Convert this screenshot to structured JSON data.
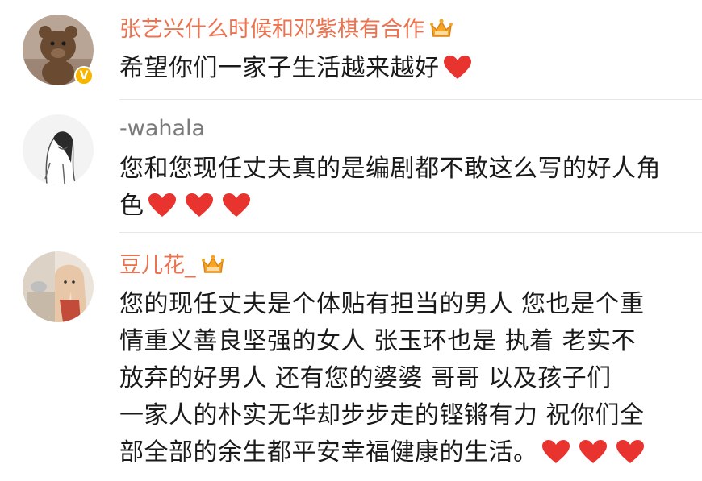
{
  "comments": [
    {
      "username": "张艺兴什么时候和邓紫棋有合作",
      "lines": [
        "希望你们一家子生活越来越好"
      ],
      "badge": "V",
      "heart_count": 1
    },
    {
      "username": "-wahala",
      "lines": [
        "您和您现任丈夫真的是编剧都不敢这么写的好人角",
        "色"
      ],
      "heart_count": 3
    },
    {
      "username": "豆儿花_",
      "lines": [
        "您的现任丈夫是个体贴有担当的男人  您也是个重",
        "情重义善良坚强的女人   张玉环也是 执着 老实不",
        "放弃的好男人  还有您的婆婆  哥哥  以及孩子们",
        "一家人的朴实无华却步步走的铿锵有力  祝你们全",
        "部全部的余生都平安幸福健康的生活。"
      ],
      "heart_count": 3
    }
  ],
  "colors": {
    "username_vip": "#eb7350",
    "username_normal": "#7a7a7a",
    "text": "#1a1a1a",
    "heart": "#e8332f",
    "crown": "#f5a623",
    "divider": "#e6e6e6"
  },
  "icons": [
    "crown-icon",
    "heart-icon",
    "verified-icon"
  ]
}
